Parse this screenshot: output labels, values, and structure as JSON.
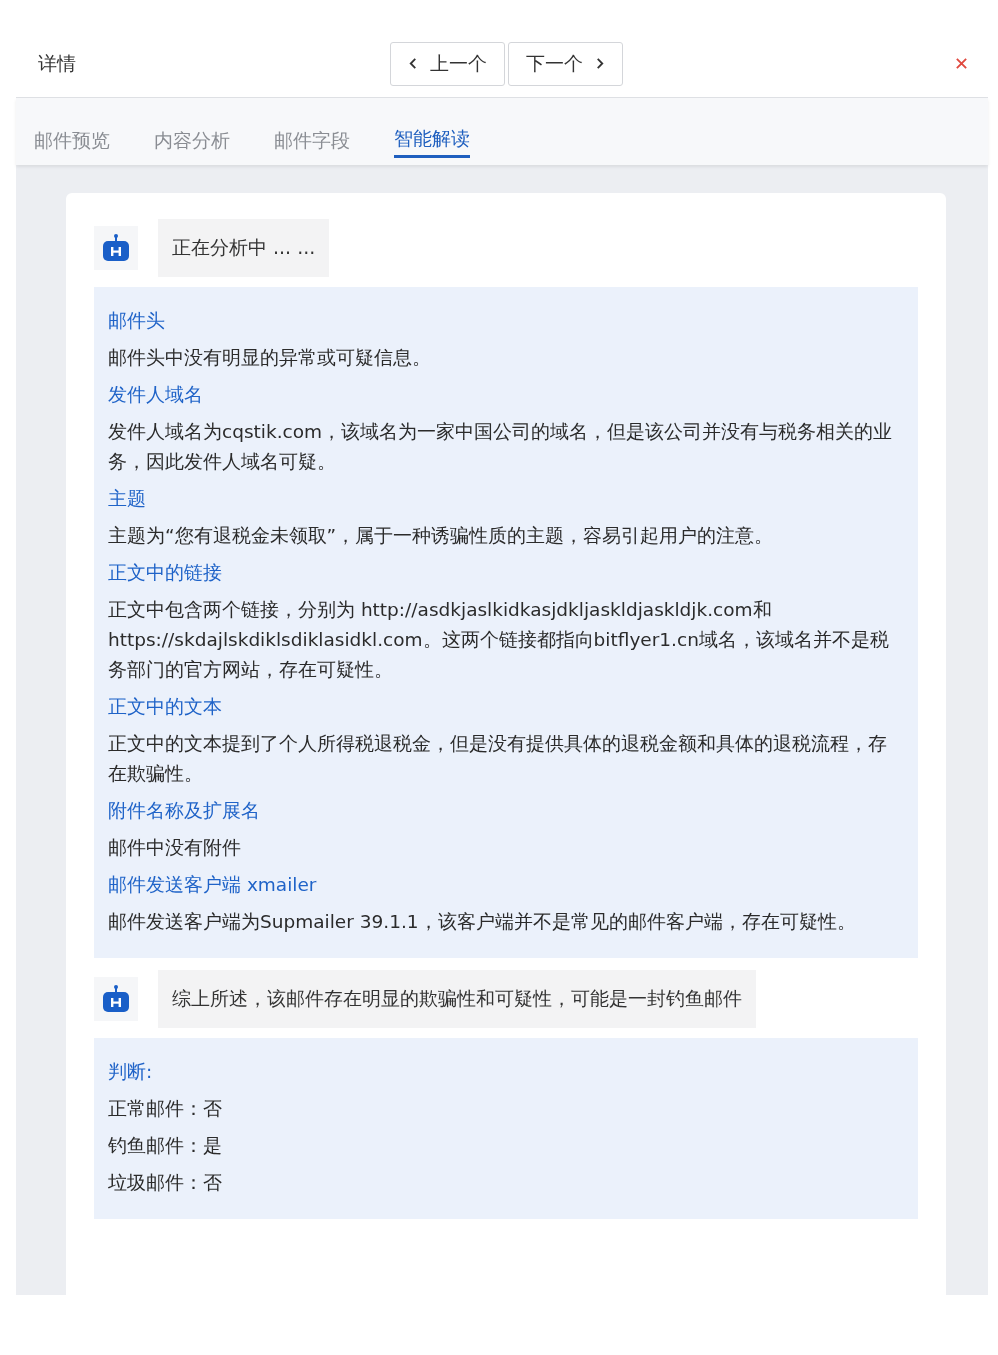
{
  "header": {
    "title": "详情",
    "prev_button": "上一个",
    "next_button": "下一个"
  },
  "tabs": [
    {
      "label": "邮件预览",
      "selected": false
    },
    {
      "label": "内容分析",
      "selected": false
    },
    {
      "label": "邮件字段",
      "selected": false
    },
    {
      "label": "智能解读",
      "selected": true
    }
  ],
  "blocks": [
    {
      "kind": "bot",
      "text": "正在分析中 ... ..."
    },
    {
      "kind": "panel",
      "lines": [
        {
          "kind": "heading",
          "text": "邮件头"
        },
        {
          "kind": "text",
          "text": "邮件头中没有明显的异常或可疑信息。"
        },
        {
          "kind": "heading",
          "text": "发件人域名"
        },
        {
          "kind": "text",
          "text": "发件人域名为cqstik.com，该域名为一家中国公司的域名，但是该公司并没有与税务相关的业务，因此发件人域名可疑。"
        },
        {
          "kind": "heading",
          "text": "主题"
        },
        {
          "kind": "text",
          "text": "主题为“您有退税金未领取”，属于一种诱骗性质的主题，容易引起用户的注意。"
        },
        {
          "kind": "heading",
          "text": "正文中的链接"
        },
        {
          "kind": "text",
          "text": "正文中包含两个链接，分别为 http://asdkjaslkidkasjdkljaskldjaskldjk.com和 https://skdajlskdiklsdiklasidkl.com。这两个链接都指向bitflyer1.cn域名，该域名并不是税务部门的官方网站，存在可疑性。"
        },
        {
          "kind": "heading",
          "text": "正文中的文本"
        },
        {
          "kind": "text",
          "text": "正文中的文本提到了个人所得税退税金，但是没有提供具体的退税金额和具体的退税流程，存在欺骗性。"
        },
        {
          "kind": "heading",
          "text": "附件名称及扩展名"
        },
        {
          "kind": "text",
          "text": "邮件中没有附件"
        },
        {
          "kind": "heading",
          "text": "邮件发送客户端 xmailer"
        },
        {
          "kind": "text",
          "text": "邮件发送客户端为Supmailer 39.1.1，该客户端并不是常见的邮件客户端，存在可疑性。"
        }
      ]
    },
    {
      "kind": "bot",
      "text": "综上所述，该邮件存在明显的欺骗性和可疑性，可能是一封钓鱼邮件"
    },
    {
      "kind": "panel",
      "lines": [
        {
          "kind": "heading",
          "text": "判断:"
        },
        {
          "kind": "text",
          "text": "正常邮件：否"
        },
        {
          "kind": "text",
          "text": "钓鱼邮件：是"
        },
        {
          "kind": "text",
          "text": "垃圾邮件：否"
        }
      ]
    }
  ]
}
